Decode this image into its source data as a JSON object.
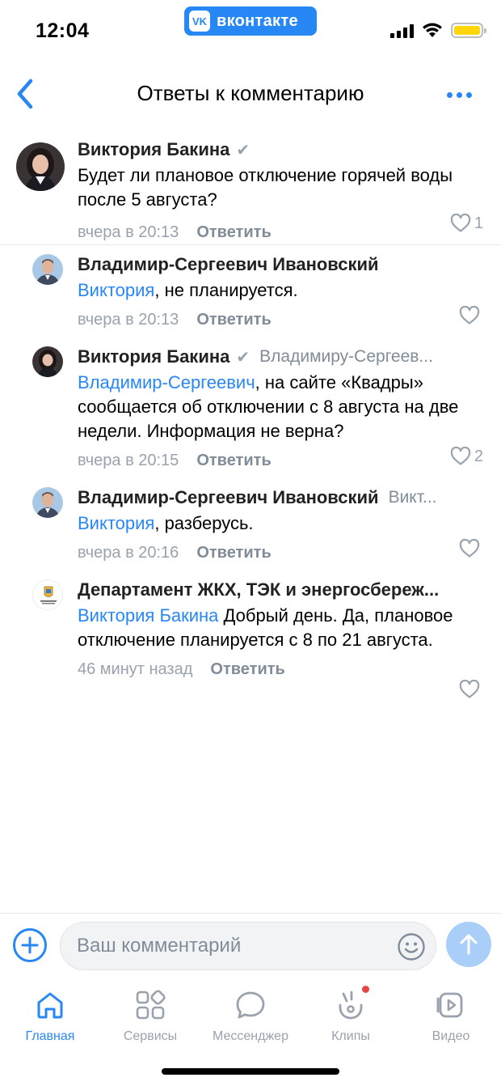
{
  "status_bar": {
    "time": "12:04",
    "app_badge": "вконтакте",
    "app_logo": "vk"
  },
  "header": {
    "title": "Ответы к комментарию",
    "back_icon": "chevron-left-icon",
    "more_icon": "more-horizontal-icon"
  },
  "comments": [
    {
      "author": "Виктория Бакина",
      "verified": true,
      "mention": "",
      "text": "Будет ли плановое отключение горячей воды после 5 августа?",
      "time": "вчера в 20:13",
      "reply_label": "Ответить",
      "likes": "1"
    },
    {
      "author": "Владимир-Сергеевич Ивановский",
      "mention": "Виктория",
      "text": ", не планируется.",
      "time": "вчера в 20:13",
      "reply_label": "Ответить",
      "likes": ""
    },
    {
      "author": "Виктория Бакина",
      "verified": true,
      "reply_to": "Владимиру-Сергеев...",
      "mention": "Владимир-Сергеевич",
      "text": ", на сайте «Квадры» сообщается об отключении с 8 августа на две недели. Информация не верна?",
      "time": "вчера в 20:15",
      "reply_label": "Ответить",
      "likes": "2"
    },
    {
      "author": "Владимир-Сергеевич Ивановский",
      "reply_to": "Викт...",
      "mention": "Виктория",
      "text": ", разберусь.",
      "time": "вчера в 20:16",
      "reply_label": "Ответить",
      "likes": ""
    },
    {
      "author": "Департамент ЖКХ, ТЭК и энергосбереж...",
      "mention": "Виктория Бакина",
      "text": " Добрый день. Да, плановое отключение планируется с 8 по 21 августа.",
      "time": "46 минут назад",
      "reply_label": "Ответить",
      "likes": ""
    }
  ],
  "input": {
    "placeholder": "Ваш комментарий",
    "attach_icon": "plus-circle-icon",
    "emoji_icon": "smile-icon",
    "send_icon": "arrow-up-icon"
  },
  "tabs": [
    {
      "label": "Главная",
      "icon": "home-icon",
      "active": true
    },
    {
      "label": "Сервисы",
      "icon": "services-icon",
      "active": false
    },
    {
      "label": "Мессенджер",
      "icon": "chat-icon",
      "active": false
    },
    {
      "label": "Клипы",
      "icon": "clips-icon",
      "active": false,
      "badge": true
    },
    {
      "label": "Видео",
      "icon": "video-icon",
      "active": false
    }
  ],
  "colors": {
    "accent": "#2787f5",
    "secondary_text": "#818c99",
    "badge": "#e64646",
    "battery": "#ffd60a"
  }
}
